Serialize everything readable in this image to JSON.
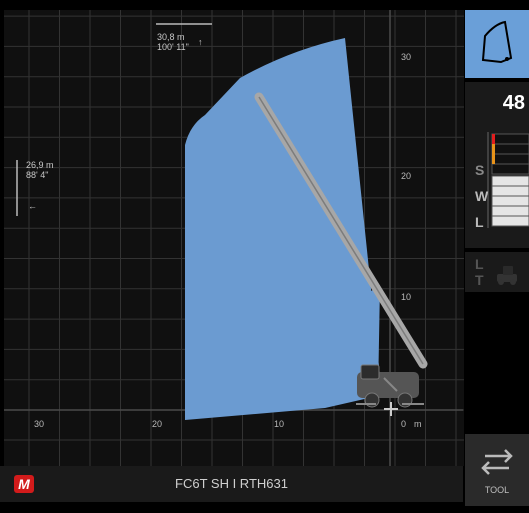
{
  "chart_data": {
    "type": "area",
    "x_ticks": [
      "30",
      "20",
      "10",
      "0"
    ],
    "x_unit": "m",
    "y_ticks": [
      "30",
      "20",
      "10"
    ],
    "max_height": {
      "metric": "30,8 m",
      "imperial": "100' 11\""
    },
    "max_reach": {
      "metric": "26,9 m",
      "imperial": "88' 4\""
    },
    "envelope_color": "#6b9bd1",
    "boom_color": "#a7a7a7",
    "grid_color": "#333333",
    "grid": true
  },
  "right_panel": {
    "boom_angle": "48",
    "scale_letters_top": [
      "S",
      "W",
      "L"
    ],
    "scale_letters_bottom": [
      "L",
      "T"
    ],
    "tool_label": "TOOL",
    "active_color": "#6a9fd8"
  },
  "bottom_bar": {
    "brand_logo": "M",
    "model": "FC6T SH I RTH631"
  }
}
